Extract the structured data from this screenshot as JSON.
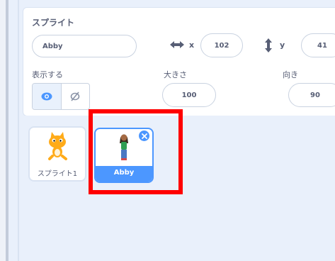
{
  "sprite_info": {
    "title": "スプライト",
    "name_value": "Abby",
    "x_label": "x",
    "x_value": "102",
    "y_label": "y",
    "y_value": "41",
    "show_label": "表示する",
    "size_label": "大きさ",
    "size_value": "100",
    "direction_label": "向き",
    "direction_value": "90"
  },
  "sprites": [
    {
      "name": "スプライト1",
      "selected": false,
      "icon": "cat-icon"
    },
    {
      "name": "Abby",
      "selected": true,
      "icon": "abby-icon"
    }
  ],
  "colors": {
    "accent": "#4c97ff",
    "highlight": "#ff0000",
    "text": "#575e75"
  }
}
